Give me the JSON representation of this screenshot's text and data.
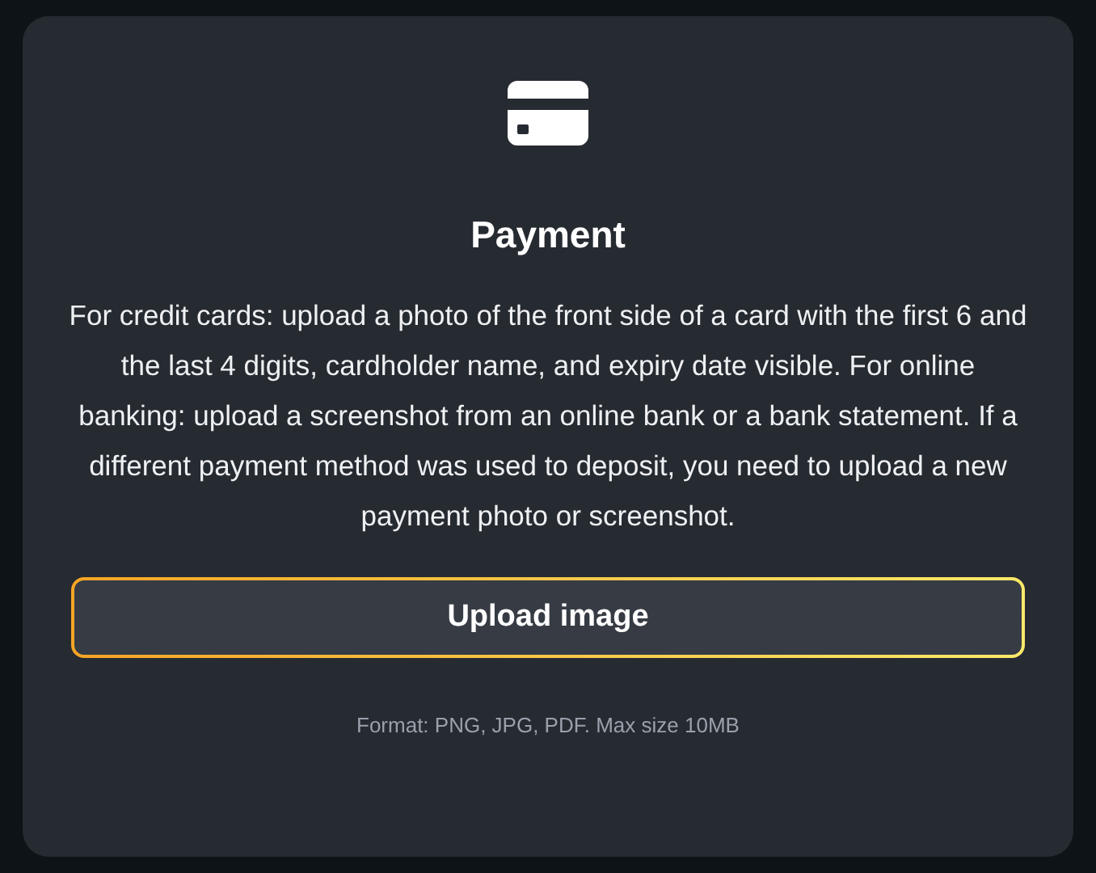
{
  "card": {
    "title": "Payment",
    "description": "For credit cards: upload a photo of the front side of a card with the first 6 and the last 4 digits, cardholder name, and expiry date visible. For online banking: upload a screenshot from an online bank or a bank statement. If a different payment method was used to deposit, you need to upload a new payment photo or screenshot.",
    "button": "Upload image",
    "hint": "Format: PNG, JPG, PDF. Max size 10MB"
  }
}
